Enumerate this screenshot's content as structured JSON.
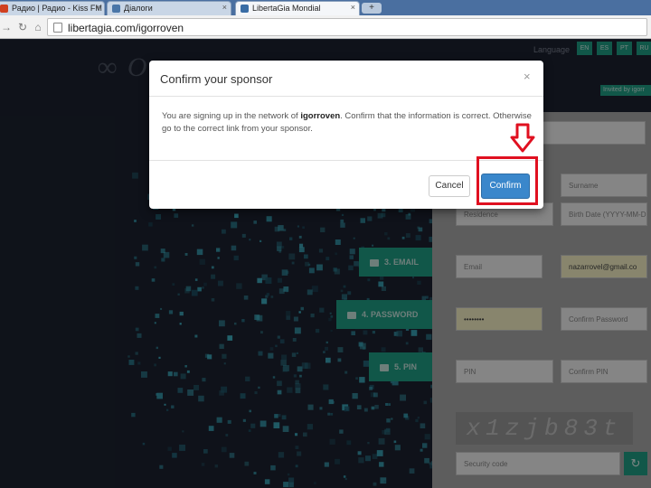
{
  "browser": {
    "tabs": [
      {
        "label": "Радио | Радио - Kiss FM",
        "active": false
      },
      {
        "label": "Діалоги",
        "active": false
      },
      {
        "label": "LibertaGia Mondial",
        "active": true
      }
    ],
    "url": "libertagia.com/igorroven"
  },
  "page": {
    "language_label": "Language",
    "languages": [
      "EN",
      "ES",
      "PT",
      "RU"
    ],
    "invited_badge": "Invited by igorr",
    "steps": [
      {
        "label": "3. EMAIL",
        "icon": "envelope-icon"
      },
      {
        "label": "4. PASSWORD",
        "icon": "lock-icon"
      },
      {
        "label": "5. PIN",
        "icon": "lock-icon"
      }
    ],
    "form": {
      "surname_placeholder": "Surname",
      "residence_placeholder": "Residence",
      "birthdate_placeholder": "Birth Date (YYYY-MM-DD)",
      "email_placeholder": "Email",
      "email_value": "nazarrovel@gmail.co",
      "password_value": "••••••••",
      "confirm_password_placeholder": "Confirm Password",
      "pin_placeholder": "PIN",
      "confirm_pin_placeholder": "Confirm PIN",
      "captcha_text": "x1zjb83t",
      "security_code_placeholder": "Security code"
    }
  },
  "modal": {
    "title": "Confirm your sponsor",
    "close": "×",
    "body_prefix": "You are signing up in the network of ",
    "sponsor": "igorroven",
    "body_suffix": ". Confirm that the information is correct. Otherwise go to the correct link from your sponsor.",
    "cancel_label": "Cancel",
    "confirm_label": "Confirm"
  },
  "colors": {
    "accent": "#1f9e86",
    "confirm": "#3a87cb",
    "annotation": "#e01020"
  }
}
